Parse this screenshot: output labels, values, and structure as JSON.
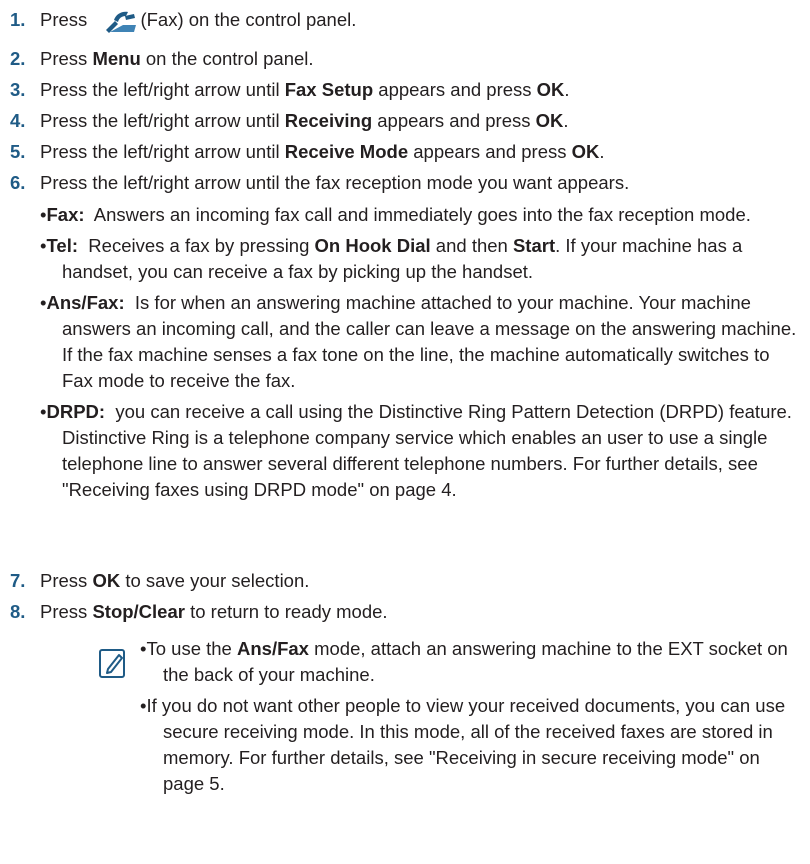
{
  "steps": [
    {
      "num": "1.",
      "pre": "Press ",
      "post": "(Fax) on the control panel.",
      "icon": "fax-icon"
    },
    {
      "num": "2.",
      "pre": "Press ",
      "bold": "Menu",
      "post": " on the control panel."
    },
    {
      "num": "3.",
      "pre": "Press the left/right arrow until ",
      "bold": "Fax Setup",
      "mid": " appears and press ",
      "bold2": "OK",
      "post": "."
    },
    {
      "num": "4.",
      "pre": "Press the left/right arrow until ",
      "bold": "Receiving",
      "mid": " appears and press ",
      "bold2": "OK",
      "post": "."
    },
    {
      "num": "5.",
      "pre": "Press the left/right arrow until ",
      "bold": "Receive Mode",
      "mid": " appears and press ",
      "bold2": "OK",
      "post": "."
    },
    {
      "num": "6.",
      "text": "Press the left/right arrow until the fax reception mode you want appears."
    },
    {
      "num": "7.",
      "pre": "Press ",
      "bold": "OK",
      "post": " to save your selection."
    },
    {
      "num": "8.",
      "pre": "Press ",
      "bold": "Stop/Clear",
      "post": " to return to ready mode."
    }
  ],
  "modes": {
    "fax": {
      "term": "Fax:",
      "desc": "Answers an incoming fax call and immediately goes into the fax reception mode."
    },
    "tel": {
      "term": "Tel:",
      "pre": "Receives a fax by pressing ",
      "b1": "On Hook Dial",
      "mid": " and then ",
      "b2": "Start",
      "post": ". If your machine has a handset, you can receive a fax by picking up the handset."
    },
    "ansfax": {
      "term": "Ans/Fax:",
      "desc": "Is for when an answering machine attached to your machine. Your machine answers an incoming call, and the caller can leave a message on the answering machine. If the fax machine senses a fax tone on the line, the machine automatically switches to Fax mode to receive the fax."
    },
    "drpd": {
      "term": "DRPD:",
      "desc": "you can receive a call using the Distinctive Ring Pattern Detection (DRPD) feature. Distinctive Ring is a telephone company service which enables an user to use a single telephone line to answer several different telephone numbers. For further details, see \"Receiving faxes using DRPD mode\" on page 4."
    }
  },
  "notes": {
    "icon": "note-pencil-icon",
    "n1": {
      "pre": "To use the ",
      "bold": "Ans/Fax",
      "post": " mode, attach an answering machine to the EXT socket on the back of your machine."
    },
    "n2": {
      "text": "If you do not want other people to view your received documents, you can use secure receiving mode. In this mode, all of the received faxes are stored in memory. For further details, see \"Receiving in secure receiving mode\" on page 5."
    }
  },
  "colors": {
    "number": "#1f5b86",
    "text": "#231f20",
    "icon": "#1f5b86"
  }
}
